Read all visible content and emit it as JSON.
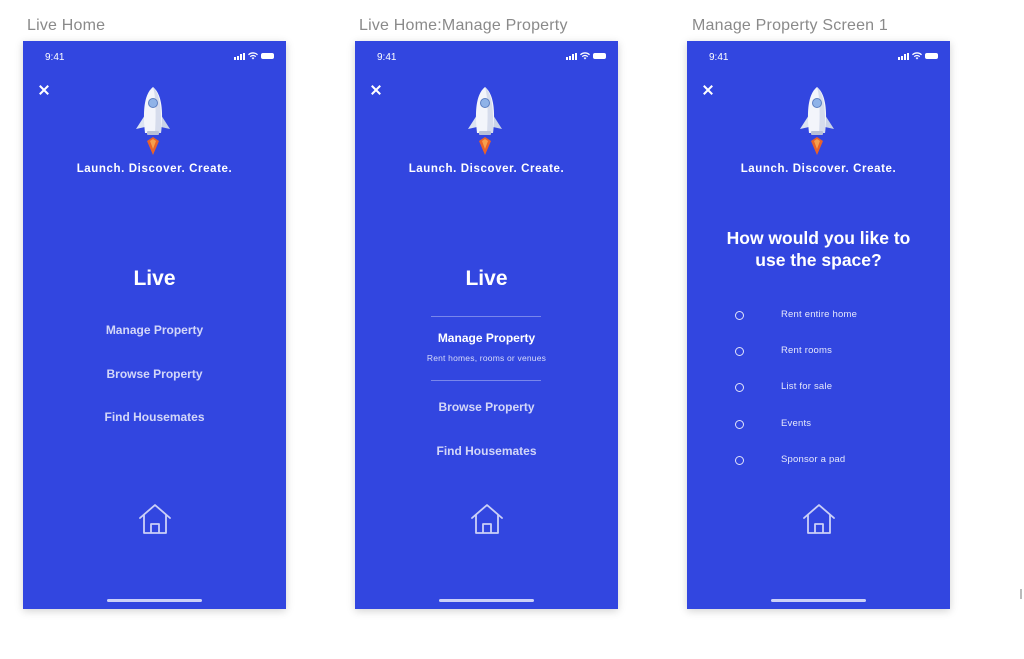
{
  "colors": {
    "screen_bg": "#3246E0",
    "rocket_flame": "#E8622A",
    "canvas_bg": "#FFFFFF"
  },
  "frames": [
    {
      "title": "Live Home",
      "status_time": "9:41",
      "tagline": "Launch. Discover. Create.",
      "section_title": "Live",
      "menu": [
        "Manage Property",
        "Browse Property",
        "Find Housemates"
      ]
    },
    {
      "title": "Live Home:Manage Property",
      "status_time": "9:41",
      "tagline": "Launch. Discover. Create.",
      "section_title": "Live",
      "menu": [
        "Manage Property",
        "Browse Property",
        "Find Housemates"
      ],
      "active_item_subtitle": "Rent homes, rooms or venues"
    },
    {
      "title": "Manage Property Screen 1",
      "status_time": "9:41",
      "tagline": "Launch. Discover. Create.",
      "question_line1": "How would you like to",
      "question_line2": "use the space?",
      "options": [
        "Rent entire home",
        "Rent rooms",
        "List for sale",
        "Events",
        "Sponsor a pad"
      ]
    }
  ],
  "icons": {
    "close": "close-icon",
    "home": "home-icon",
    "rocket": "rocket-illustration",
    "signal": "signal-icon",
    "wifi": "wifi-icon",
    "battery": "battery-icon"
  }
}
